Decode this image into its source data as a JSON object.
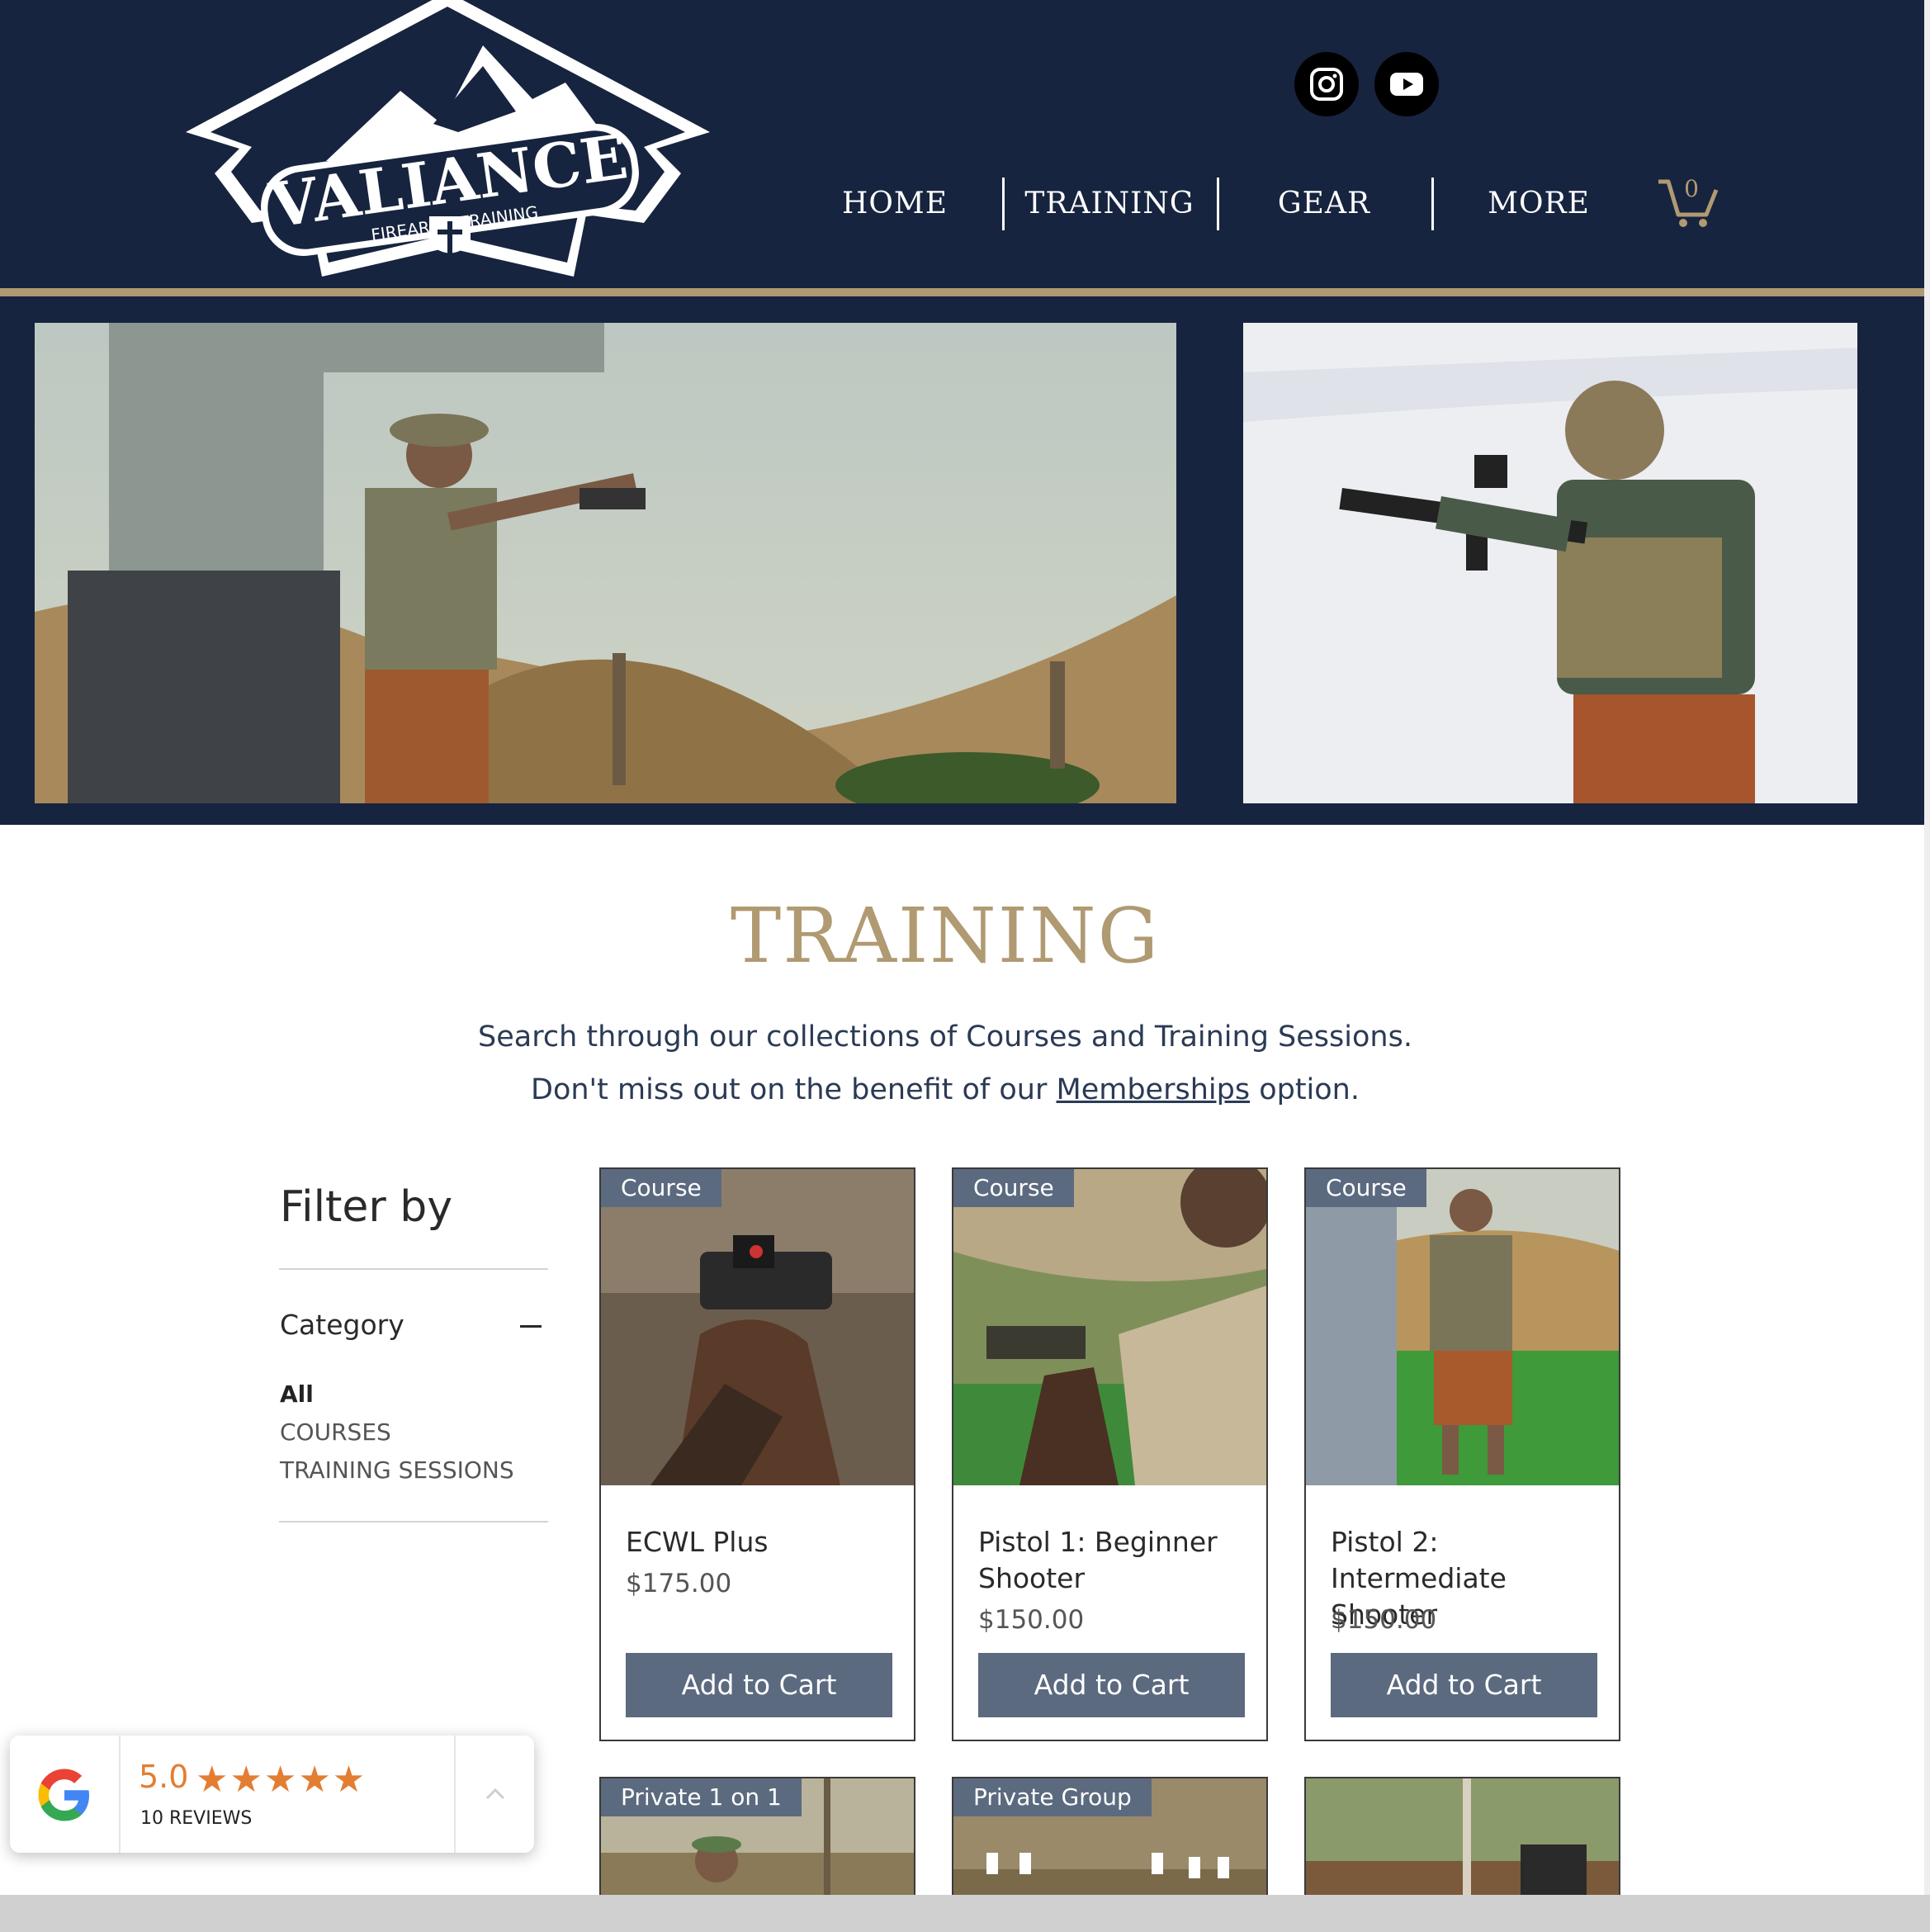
{
  "header": {
    "logo": {
      "name": "VALIANCE",
      "tagline": "FIREARMS TRAINING"
    },
    "social": [
      "instagram-icon",
      "youtube-icon"
    ],
    "nav": [
      "HOME",
      "TRAINING",
      "GEAR",
      "MORE"
    ],
    "cart_count": "0"
  },
  "hero": {
    "images": [
      "pistol-shooter-desert-photo",
      "rifle-shooter-snow-photo"
    ]
  },
  "page": {
    "title": "TRAINING",
    "intro_line1": "Search through our collections of Courses and Training Sessions.",
    "intro_line2_before": "Don't miss out on the benefit of our ",
    "intro_link": "Memberships",
    "intro_line2_after": " option."
  },
  "filter": {
    "title": "Filter by",
    "category_label": "Category",
    "options": [
      "All",
      "COURSES",
      "TRAINING SESSIONS"
    ],
    "selected": "All"
  },
  "products": [
    {
      "badge": "Course",
      "name": "ECWL Plus",
      "price": "$175.00",
      "button": "Add to Cart"
    },
    {
      "badge": "Course",
      "name": "Pistol 1: Beginner Shooter",
      "price": "$150.00",
      "button": "Add to Cart"
    },
    {
      "badge": "Course",
      "name": "Pistol 2: Intermediate Shooter",
      "price": "$150.00",
      "button": "Add to Cart"
    }
  ],
  "products_row2": [
    {
      "badge": "Private 1 on 1"
    },
    {
      "badge": "Private Group"
    },
    {
      "badge": ""
    }
  ],
  "reviews_widget": {
    "rating": "5.0",
    "stars": "★★★★★",
    "count_label": "10 REVIEWS"
  },
  "colors": {
    "navy": "#17243f",
    "gold": "#b09a72",
    "button": "#5b6a7f",
    "star": "#e37d32"
  }
}
